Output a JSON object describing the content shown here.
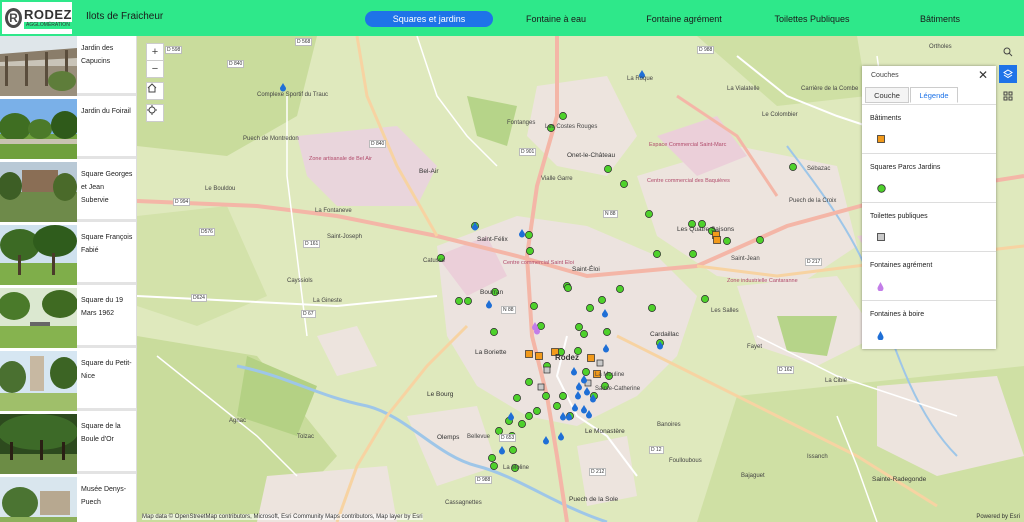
{
  "header": {
    "logo_name": "RODEZ",
    "logo_sub": "AGGLOMÉRATION",
    "logo_letter": "R",
    "app_title": "Ilots de Fraicheur",
    "tabs": [
      {
        "label": "Squares et jardins",
        "active": true
      },
      {
        "label": "Fontaine à eau",
        "active": false
      },
      {
        "label": "Fontaine agrément",
        "active": false
      },
      {
        "label": "Toilettes Publiques",
        "active": false
      },
      {
        "label": "Bâtiments",
        "active": false
      }
    ]
  },
  "sidebar": {
    "items": [
      {
        "label": "Jardin des Capucins"
      },
      {
        "label": "Jardin du Foirail"
      },
      {
        "label": "Square Georges et Jean Subervie"
      },
      {
        "label": "Square François Fabié"
      },
      {
        "label": "Square du 19 Mars 1962"
      },
      {
        "label": "Square du Petit-Nice"
      },
      {
        "label": "Square de la Boule d'Or"
      },
      {
        "label": "Musée Denys-Puech"
      }
    ]
  },
  "map": {
    "zoom_in": "+",
    "zoom_out": "−",
    "attribution": "Map data © OpenStreetMap contributors, Microsoft, Esri Community Maps contributors, Map layer by Esri",
    "powered_by": "Powered by Esri",
    "labels": {
      "rodez": "Rodez",
      "onet": "Onet-le-Château",
      "bel_air": "Bel-Air",
      "saint_felix": "Saint-Félix",
      "quatre_saisons": "Les Quatre Saisons",
      "saint_eloi": "Saint-Éloi",
      "cardaillac": "Cardaillac",
      "le_monastere": "Le Monastère",
      "olemps": "Olemps",
      "sainte_radegonde": "Sainte-Radegonde",
      "olemps_sud": "Puech de la Sole",
      "bourran": "Bourran",
      "le_bourg": "Le Bourg",
      "la_boriette": "La Boriette",
      "zone_bel_air": "Zone artisanale de Bel Air",
      "espace_saint_marc": "Espace Commercial Saint-Marc",
      "centre_baquieres": "Centre commercial des Baquières",
      "zone_cantaranne": "Zone industrielle Cantaranne",
      "centre_saint_eloi": "Centre commercial Saint Eloi",
      "les_costes": "Les Costes Rouges",
      "fontanges": "Fontanges",
      "orthoies": "Ortholes",
      "le_vialatelle": "La Vialatelle",
      "le_colombier": "Le Colombier",
      "la_roque": "La Roque",
      "complexe_trauc": "Complexe Sportif du Trauc",
      "puech_montredon": "Puech de Montredon",
      "le_bouldou": "Le Bouldou",
      "la_fontaneve": "La Fontaneve",
      "saint_joseph": "Saint-Joseph",
      "catusse": "Catusse",
      "cayssiols": "Cayssiols",
      "la_gineste": "La Gineste",
      "banoires": "Banoires",
      "faget": "Fayet",
      "la_cible": "La Cible",
      "issanch": "Issanch",
      "bajaguet": "Bajaguet",
      "foullbous": "Foulloubous",
      "cassagnettes": "Cassagnettes",
      "bellevue": "Bellevue",
      "tolzac": "Tolzac",
      "agnac": "Agnac",
      "les_moulins": "La Moline",
      "sainte_catherine": "Sainte-Catherine",
      "la_mouline": "La Mouline",
      "saint_jean": "Saint-Jean",
      "sebazac": "Sébazac",
      "lasselles": "Les Salles",
      "puech_de_la_croix": "Puech de la Croix",
      "vialle_garre": "Vialle Garre",
      "combes": "Carrière de la Combe",
      "d598": "D 598",
      "d568": "D 568",
      "d840": "D 840",
      "d994": "D 994",
      "d576": "D576",
      "d161": "D 161",
      "d624": "D624",
      "d67": "D 67",
      "d988": "D 988",
      "n88": "N 88",
      "d901": "D 901",
      "d217": "D 217",
      "d12": "D 12",
      "d653": "D 653",
      "d212": "D 212",
      "d162": "D 162",
      "d62": "D 62",
      "d888": "D 888"
    }
  },
  "panel": {
    "title": "Couches",
    "tab_couche": "Couche",
    "tab_legende": "Légende",
    "sections": [
      {
        "label": "Bâtiments",
        "symbol": "orange-square"
      },
      {
        "label": "Squares Parcs Jardins",
        "symbol": "green-circle"
      },
      {
        "label": "Toilettes publiques",
        "symbol": "grey-square"
      },
      {
        "label": "Fontaines agrément",
        "symbol": "purple-drop"
      },
      {
        "label": "Fontaines à boire",
        "symbol": "blue-drop"
      }
    ]
  },
  "colors": {
    "header_bg": "#2ee88a",
    "accent": "#1e73e8",
    "park_green": "#4ed12b",
    "building_orange": "#f29a1b",
    "fountain_blue": "#1f6fd6"
  }
}
